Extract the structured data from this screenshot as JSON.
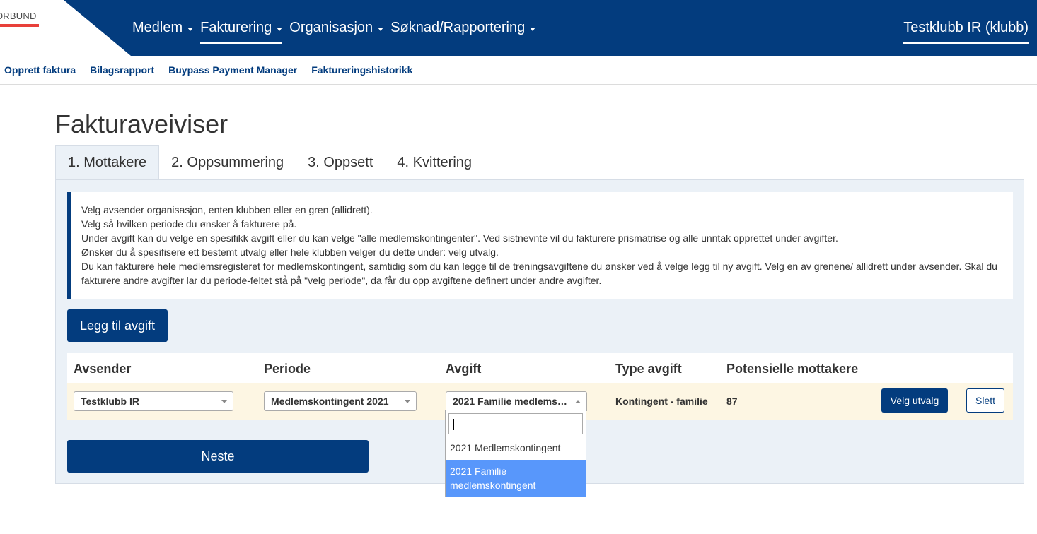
{
  "logo": {
    "text": "ORBUND"
  },
  "nav": {
    "items": [
      {
        "label": "Medlem",
        "active": false
      },
      {
        "label": "Fakturering",
        "active": true
      },
      {
        "label": "Organisasjon",
        "active": false
      },
      {
        "label": "Søknad/Rapportering",
        "active": false
      }
    ],
    "club": "Testklubb IR (klubb)"
  },
  "subnav": {
    "links": [
      "Opprett faktura",
      "Bilagsrapport",
      "Buypass Payment Manager",
      "Faktureringshistorikk"
    ]
  },
  "page": {
    "title": "Fakturaveiviser"
  },
  "tabs": [
    "1. Mottakere",
    "2. Oppsummering",
    "3. Oppsett",
    "4. Kvittering"
  ],
  "info": {
    "lines": [
      "Velg avsender organisasjon, enten klubben eller en gren (allidrett).",
      "Velg så hvilken periode du ønsker å fakturere på.",
      "Under avgift kan du velge en spesifikk avgift eller du kan velge \"alle medlemskontingenter\". Ved sistnevnte vil du fakturere prismatrise og alle unntak opprettet under avgifter.",
      "Ønsker du å spesifisere ett bestemt utvalg eller hele klubben velger du dette under: velg utvalg.",
      "Du kan fakturere hele medlemsregisteret for medlemskontingent, samtidig som du kan legge til de treningsavgiftene du ønsker ved å velge legg til ny avgift. Velg en av grenene/ allidrett under avsender. Skal du fakturere andre avgifter lar du periode-feltet stå på \"velg periode\", da får du opp avgiftene definert under andre avgifter."
    ]
  },
  "buttons": {
    "add_fee": "Legg til avgift",
    "select_group": "Velg utvalg",
    "delete": "Slett",
    "next": "Neste"
  },
  "table": {
    "headers": [
      "Avsender",
      "Periode",
      "Avgift",
      "Type avgift",
      "Potensielle mottakere"
    ],
    "row": {
      "avsender": "Testklubb IR",
      "periode": "Medlemskontingent 2021",
      "avgift": "2021 Familie medlemskontingent",
      "type_avgift": "Kontingent - familie",
      "mottakere": "87"
    }
  },
  "dropdown": {
    "search_value": "",
    "options": [
      {
        "label": "2021 Medlemskontingent",
        "highlighted": false
      },
      {
        "label": "2021 Familie medlemskontingent",
        "highlighted": true
      }
    ]
  },
  "colors": {
    "brand": "#033c7e",
    "panel_bg": "#ebf1f7",
    "row_bg": "#fdf6e3",
    "highlight": "#5897fb",
    "logo_red": "#e8403a"
  }
}
